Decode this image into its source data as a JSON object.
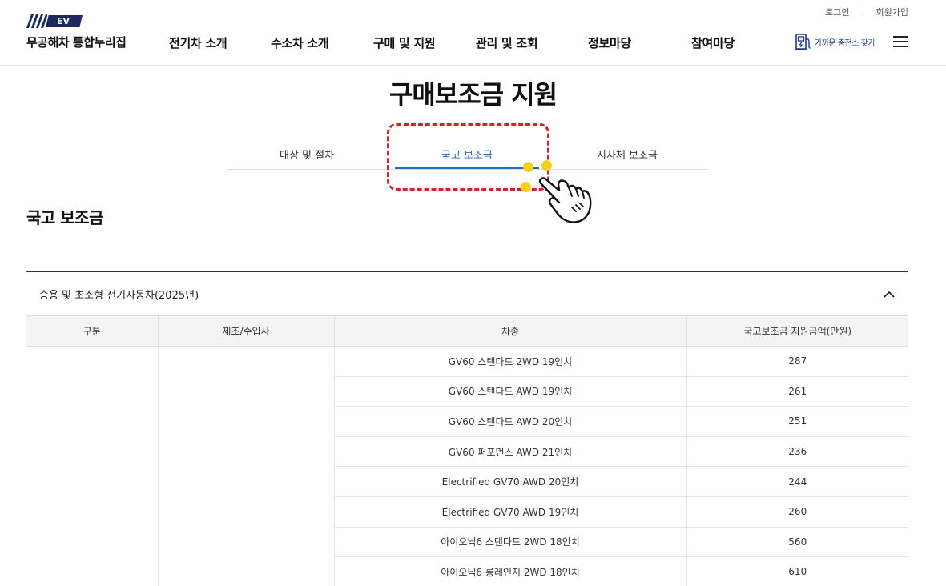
{
  "util_links": {
    "login": "로그인",
    "join": "회원가입"
  },
  "logo": {
    "badge": "EV",
    "name": "무공해차 통합누리집"
  },
  "nav": [
    "전기차 소개",
    "수소차 소개",
    "구매 및 지원",
    "관리 및 조회",
    "정보마당",
    "참여마당"
  ],
  "charger_link": "가까운 충전소 찾기",
  "page_title": "구매보조금 지원",
  "tabs": [
    {
      "label": "대상 및 절차",
      "active": false
    },
    {
      "label": "국고 보조금",
      "active": true
    },
    {
      "label": "지자체 보조금",
      "active": false
    }
  ],
  "section_title": "국고 보조금",
  "accordion": {
    "title": "승용 및 초소형 전기자동차(2025년)"
  },
  "table": {
    "headers": [
      "구분",
      "제조/수입사",
      "차종",
      "국고보조금 지원금액(만원)"
    ],
    "rows": [
      {
        "model": "GV60 스탠다드 2WD 19인치",
        "amount": "287"
      },
      {
        "model": "GV60 스탠다드 AWD 19인치",
        "amount": "261"
      },
      {
        "model": "GV60 스탠다드 AWD 20인치",
        "amount": "251"
      },
      {
        "model": "GV60 퍼포먼스 AWD 21인치",
        "amount": "236"
      },
      {
        "model": "Electrified GV70 AWD 20인치",
        "amount": "244"
      },
      {
        "model": "Electrified GV70 AWD 19인치",
        "amount": "260"
      },
      {
        "model": "아이오닉6 스탠다드 2WD 18인치",
        "amount": "560"
      },
      {
        "model": "아이오닉6 롱레인지 2WD 18인치",
        "amount": "610"
      }
    ]
  },
  "colors": {
    "accent": "#2a6ab8",
    "highlight": "#d6202a",
    "navy": "#1b2a5e",
    "dot": "#f3d21c"
  }
}
